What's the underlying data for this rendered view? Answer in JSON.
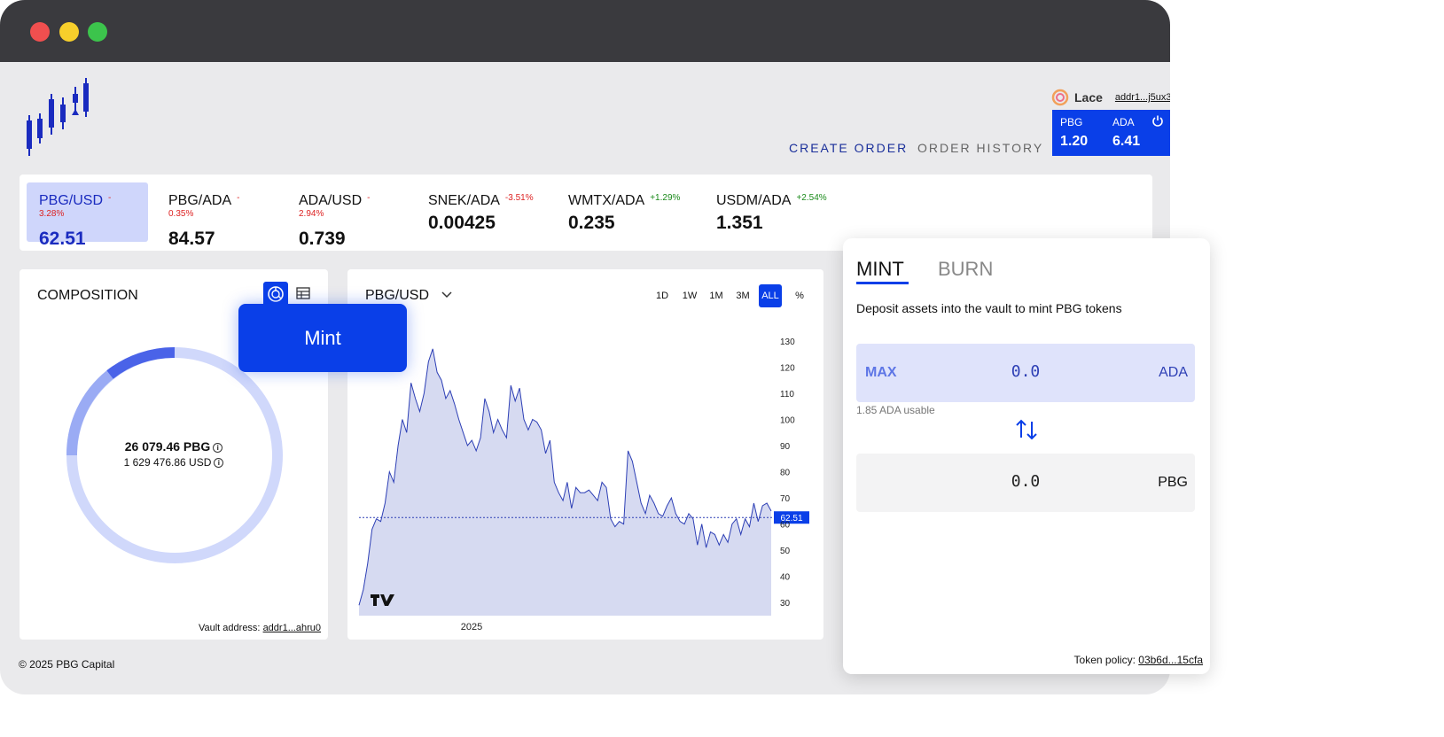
{
  "window": {
    "controls": [
      {
        "name": "close",
        "color": "#f04f4f"
      },
      {
        "name": "minimize",
        "color": "#f7cf2b"
      },
      {
        "name": "maximize",
        "color": "#3cc44c"
      }
    ]
  },
  "wallet": {
    "name": "Lace",
    "address": "addr1...j5ux3",
    "balances": [
      {
        "label": "PBG",
        "value": "1.20"
      },
      {
        "label": "ADA",
        "value": "6.41"
      }
    ]
  },
  "nav": {
    "create_order": "CREATE ORDER",
    "order_history": "ORDER HISTORY"
  },
  "ticker": [
    {
      "pair": "PBG/USD",
      "change": "-3.28%",
      "value": "62.51",
      "active": true
    },
    {
      "pair": "PBG/ADA",
      "change": "-0.35%",
      "value": "84.57"
    },
    {
      "pair": "ADA/USD",
      "change": "-2.94%",
      "value": "0.739"
    },
    {
      "pair": "SNEK/ADA",
      "change": "-3.51%",
      "value": "0.00425"
    },
    {
      "pair": "WMTX/ADA",
      "change": "+1.29%",
      "value": "0.235"
    },
    {
      "pair": "USDM/ADA",
      "change": "+2.54%",
      "value": "1.351"
    }
  ],
  "composition": {
    "title": "COMPOSITION",
    "total_pbg": "26 079.46 PBG",
    "total_usd": "1 629 476.86 USD",
    "vault_label": "Vault address:",
    "vault_address": "addr1...ahru0",
    "colors": {
      "primary": "#4a63e8",
      "secondary": "#9aabf4",
      "tertiary": "#d0d8fb"
    }
  },
  "price_chart": {
    "pair": "PBG/USD",
    "timeframes": [
      "1D",
      "1W",
      "1M",
      "3M",
      "ALL",
      "%"
    ],
    "selected_timeframe": "ALL",
    "last_price": "62.51"
  },
  "chart_data": {
    "type": "area",
    "x_tick_labels": [
      "2025"
    ],
    "y_ticks": [
      30,
      40,
      50,
      60,
      70,
      80,
      90,
      100,
      110,
      120,
      130
    ],
    "ylim": [
      25,
      132
    ],
    "current_price": 62.51,
    "series": [
      {
        "values": [
          29,
          35,
          45,
          58,
          62,
          61,
          68,
          80,
          76,
          90,
          100,
          95,
          114,
          108,
          103,
          110,
          122,
          127,
          118,
          115,
          108,
          111,
          106,
          100,
          95,
          90,
          92,
          88,
          93,
          108,
          103,
          95,
          100,
          96,
          93,
          113,
          107,
          112,
          100,
          96,
          100,
          99,
          96,
          87,
          92,
          76,
          72,
          69,
          76,
          66,
          74,
          72,
          72,
          73,
          71,
          69,
          76,
          74,
          62,
          59,
          61,
          60,
          88,
          84,
          76,
          68,
          64,
          71,
          68,
          64,
          63,
          67,
          70,
          64,
          61,
          60,
          64,
          62,
          52,
          60,
          51,
          57,
          56,
          52,
          56,
          53,
          60,
          62,
          56,
          62,
          59,
          68,
          61,
          67,
          68,
          65
        ]
      }
    ]
  },
  "mint": {
    "tab_mint": "MINT",
    "tab_burn": "BURN",
    "description": "Deposit assets into the vault to mint PBG tokens",
    "max_label": "MAX",
    "input_amount": "0.0",
    "input_unit": "ADA",
    "usable": "1.85 ADA usable",
    "output_amount": "0.0",
    "output_unit": "PBG",
    "button": "Mint",
    "policy_label": "Token policy:",
    "policy_id": "03b6d...15cfa"
  },
  "footer": "© 2025 PBG Capital",
  "colors": {
    "accent": "#0a3fe8",
    "negative": "#dd2222",
    "positive": "#1a8a1a"
  }
}
